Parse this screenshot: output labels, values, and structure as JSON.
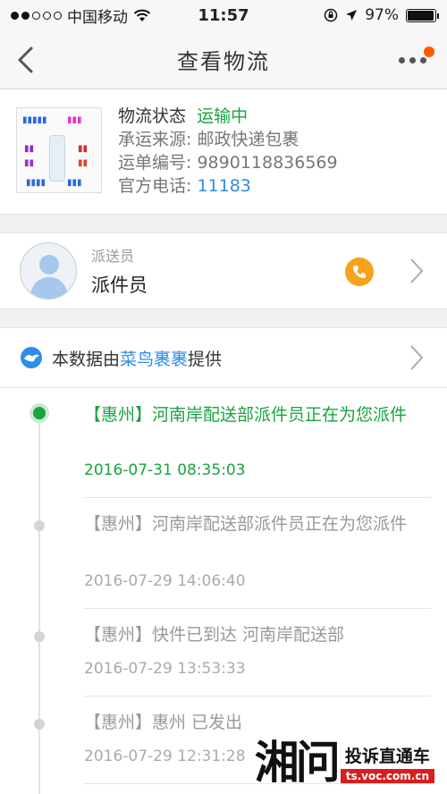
{
  "status_bar": {
    "carrier": "中国移动",
    "time": "11:57",
    "battery": "97%",
    "battery_level": 0.97
  },
  "nav": {
    "title": "查看物流"
  },
  "shipment": {
    "status_label": "物流状态",
    "status_value": "运输中",
    "carrier_label": "承运来源:",
    "carrier_value": "邮政快递包裹",
    "tracking_label": "运单编号:",
    "tracking_value": "9890118836569",
    "phone_label": "官方电话:",
    "phone_value": "11183"
  },
  "courier": {
    "role": "派送员",
    "name": "派件员"
  },
  "source": {
    "prefix": "本数据由",
    "provider": "菜鸟裹裹",
    "suffix": "提供"
  },
  "timeline": [
    {
      "text": "【惠州】河南岸配送部派件员正在为您派件",
      "time": "2016-07-31 08:35:03"
    },
    {
      "text": "【惠州】河南岸配送部派件员正在为您派件",
      "time": "2016-07-29 14:06:40"
    },
    {
      "text": "【惠州】快件已到达 河南岸配送部",
      "time": "2016-07-29 13:53:33"
    },
    {
      "text": "【惠州】惠州 已发出",
      "time": "2016-07-29 12:31:28"
    }
  ],
  "watermark": {
    "logo": "湘问",
    "title": "投诉直通车",
    "url": "ts.voc.com.cn"
  },
  "colors": {
    "accent_green": "#1aa33f",
    "link_blue": "#2f8de4",
    "call_orange": "#f7a21b",
    "badge_red": "#ff5a00"
  }
}
